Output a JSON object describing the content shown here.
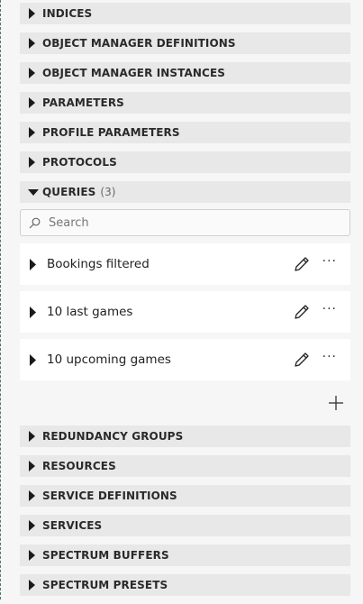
{
  "sections_top": [
    {
      "label": "INDICES"
    },
    {
      "label": "OBJECT MANAGER DEFINITIONS"
    },
    {
      "label": "OBJECT MANAGER INSTANCES"
    },
    {
      "label": "PARAMETERS"
    },
    {
      "label": "PROFILE PARAMETERS"
    },
    {
      "label": "PROTOCOLS"
    }
  ],
  "queries": {
    "label": "QUERIES",
    "count": "(3)",
    "search_placeholder": "Search",
    "items": [
      {
        "label": "Bookings filtered"
      },
      {
        "label": "10 last games"
      },
      {
        "label": "10 upcoming games"
      }
    ],
    "more_label": "···"
  },
  "sections_bottom": [
    {
      "label": "REDUNDANCY GROUPS"
    },
    {
      "label": "RESOURCES"
    },
    {
      "label": "SERVICE DEFINITIONS"
    },
    {
      "label": "SERVICES"
    },
    {
      "label": "SPECTRUM BUFFERS"
    },
    {
      "label": "SPECTRUM PRESETS"
    }
  ]
}
